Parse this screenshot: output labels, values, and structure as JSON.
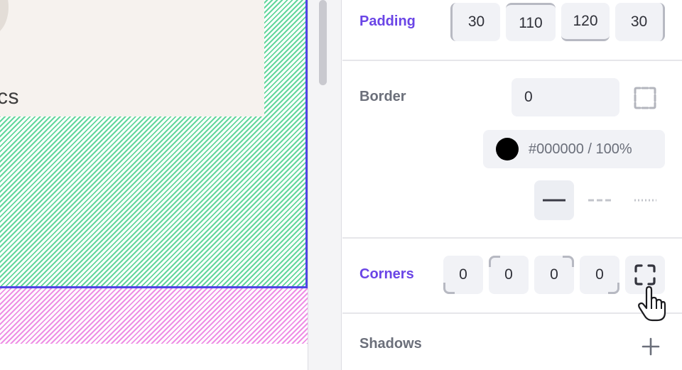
{
  "canvas": {
    "card_text": "cs"
  },
  "inspector": {
    "padding": {
      "label": "Padding",
      "values": [
        "30",
        "110",
        "120",
        "30"
      ]
    },
    "border": {
      "label": "Border",
      "width": "0",
      "color_text": "#000000 / 100%",
      "color_hex": "#000000",
      "styles": [
        "solid",
        "dashed",
        "dotted"
      ],
      "selected_style": "solid"
    },
    "corners": {
      "label": "Corners",
      "values": [
        "0",
        "0",
        "0",
        "0"
      ]
    },
    "shadows": {
      "label": "Shadows"
    }
  },
  "colors": {
    "accent": "#6a45e6",
    "selection_outline": "#4f46e5",
    "canvas_green": "#62d79c",
    "canvas_pink": "#ee8ee5",
    "card_bg": "#f6f2ee"
  }
}
